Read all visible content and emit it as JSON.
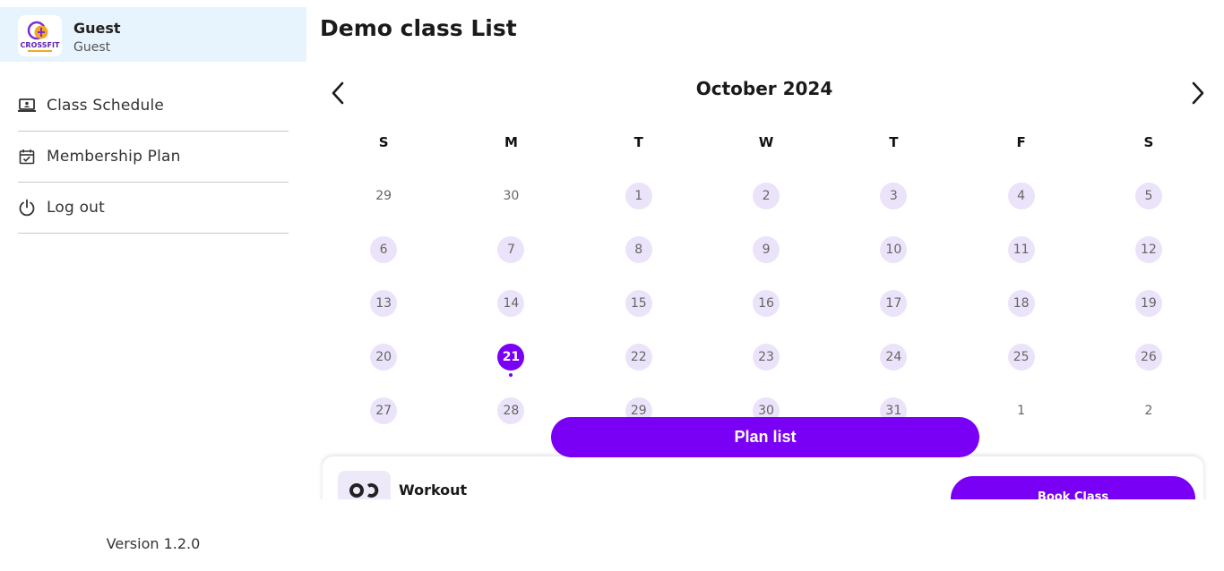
{
  "sidebar": {
    "profile": {
      "name": "Guest",
      "role": "Guest",
      "logo_text": "CROSSFIT"
    },
    "items": [
      {
        "label": "Class Schedule",
        "icon": "laptop-icon"
      },
      {
        "label": "Membership Plan",
        "icon": "calendar-check-icon"
      },
      {
        "label": "Log out",
        "icon": "power-icon"
      }
    ],
    "version": "Version 1.2.0"
  },
  "main": {
    "title": "Demo class List",
    "calendar": {
      "month_label": "October 2024",
      "weekdays": [
        "S",
        "M",
        "T",
        "W",
        "T",
        "F",
        "S"
      ],
      "days": [
        [
          "29",
          "30",
          "1",
          "2",
          "3",
          "4",
          "5"
        ],
        [
          "6",
          "7",
          "8",
          "9",
          "10",
          "11",
          "12"
        ],
        [
          "13",
          "14",
          "15",
          "16",
          "17",
          "18",
          "19"
        ],
        [
          "20",
          "21",
          "22",
          "23",
          "24",
          "25",
          "26"
        ],
        [
          "27",
          "28",
          "29",
          "30",
          "31",
          "1",
          "2"
        ]
      ],
      "selected_day": "21"
    },
    "plan_button": "Plan list",
    "class_card": {
      "title": "Workout",
      "book_button": "Book Class"
    }
  },
  "colors": {
    "accent": "#7a00f5",
    "day_bg": "#ebe3fa",
    "profile_bg": "#e8f4fd"
  }
}
